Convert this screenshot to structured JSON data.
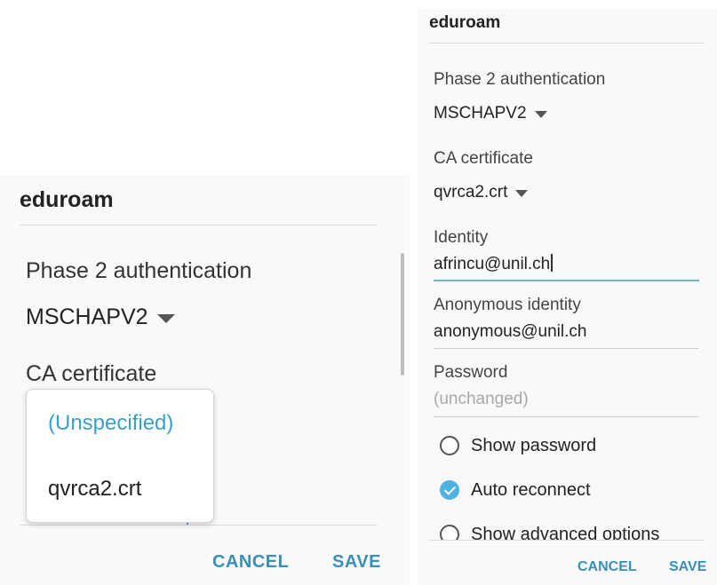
{
  "left": {
    "title": "eduroam",
    "phase2_label": "Phase 2 authentication",
    "phase2_value": "MSCHAPV2",
    "ca_label": "CA certificate",
    "dropdown_options": [
      "(Unspecified)",
      "qvrca2.crt"
    ],
    "dropdown_selected": "(Unspecified)",
    "cancel": "CANCEL",
    "save": "SAVE"
  },
  "right": {
    "title": "eduroam",
    "phase2_label": "Phase 2 authentication",
    "phase2_value": "MSCHAPV2",
    "ca_label": "CA certificate",
    "ca_value": "qvrca2.crt",
    "identity_label": "Identity",
    "identity_value": "afrincu@unil.ch",
    "anon_label": "Anonymous identity",
    "anon_value": "anonymous@unil.ch",
    "password_label": "Password",
    "password_placeholder": "(unchanged)",
    "show_password": "Show password",
    "show_password_checked": false,
    "auto_reconnect": "Auto reconnect",
    "auto_reconnect_checked": true,
    "advanced": "Show advanced options",
    "advanced_checked": false,
    "cancel": "CANCEL",
    "save": "SAVE"
  },
  "colors": {
    "accent": "#3a8fb7",
    "selected_option": "#3a9fc9",
    "checkbox_on": "#4db3e3",
    "active_underline": "#6db7da"
  },
  "icons": [
    "dropdown-caret-icon",
    "checkbox-icon"
  ]
}
